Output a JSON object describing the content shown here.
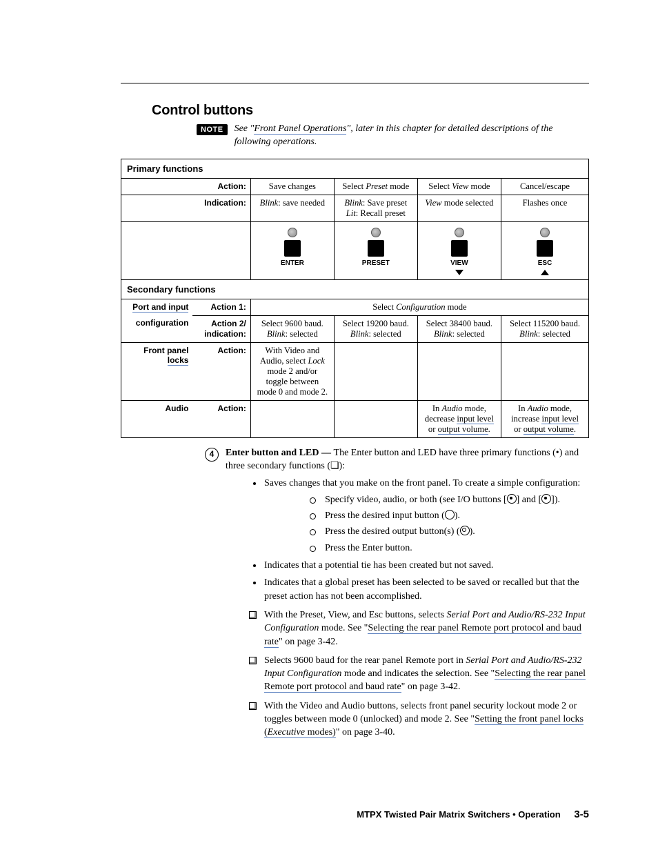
{
  "section_title": "Control buttons",
  "note": {
    "badge": "NOTE",
    "text_prefix": "See \"",
    "link": "Front Panel Operations",
    "text_suffix": "\", later in this chapter for detailed descriptions of the following operations."
  },
  "table": {
    "primary_header": "Primary functions",
    "secondary_header": "Secondary functions",
    "labels": {
      "action": "Action:",
      "indication": "Indication:",
      "action1": "Action 1:",
      "action2": "Action 2/ indication:",
      "port_input": "Port and input",
      "configuration": "configuration",
      "front_panel": "Front panel",
      "locks": "locks",
      "audio": "Audio"
    },
    "primary": {
      "action": [
        "Save changes",
        "Select Preset mode",
        "Select View mode",
        "Cancel/escape"
      ],
      "indication": [
        "Blink: save needed",
        "Blink: Save preset\nLit: Recall preset",
        "View mode selected",
        "Flashes once"
      ]
    },
    "buttons": [
      "ENTER",
      "PRESET",
      "VIEW",
      "ESC"
    ],
    "sec_action1": "Select Configuration mode",
    "sec_action2": [
      "Select 9600 baud.\nBlink: selected",
      "Select 19200 baud.\nBlink: selected",
      "Select 38400 baud.\nBlink: selected",
      "Select 115200 baud.\nBlink: selected"
    ],
    "locks_action": "With Video and Audio, select Lock mode 2 and/or toggle between mode 0 and mode 2.",
    "audio_actions": {
      "view": "In Audio mode, decrease input level or output volume.",
      "esc": "In Audio mode, increase input level or output volume."
    }
  },
  "item": {
    "num": "4",
    "lead": "Enter button and LED — ",
    "lead_rest": "The Enter button and LED have three primary functions (•) and three secondary functions (❏):",
    "bul1": "Saves changes that you make on the front panel.  To create a simple configuration:",
    "circ": [
      "Specify video, audio, or both (see I/O buttons [",
      "Press the desired input button (",
      "Press the desired output button(s) (",
      "Press the Enter button."
    ],
    "circ_tail": [
      "] and [",
      "]).",
      ").",
      ")."
    ],
    "bul2": "Indicates that a potential tie has been created but not saved.",
    "bul3": "Indicates that a global preset has been selected to be saved or recalled but that the preset action has not been accomplished.",
    "sq1a": "With the Preset, View, and Esc buttons, selects ",
    "sq1i": "Serial Port and Audio/RS-232 Input Configuration",
    "sq1b": " mode.  See \"",
    "sq1link": "Selecting the rear panel Remote port protocol and baud rate",
    "sq1c": "\" on page 3-42.",
    "sq2a": "Selects 9600 baud for the rear panel Remote port in ",
    "sq2i": "Serial Port and Audio/RS-232 Input Configuration",
    "sq2b": " mode and indicates the selection.  See \"",
    "sq2link": "Selecting the rear panel Remote port protocol and baud rate",
    "sq2c": "\" on page 3-42.",
    "sq3a": "With the Video and Audio buttons, selects front panel security lockout mode 2 or toggles between mode 0 (unlocked) and mode 2.  See \"",
    "sq3link": "Setting the front panel locks (",
    "sq3i": "Executive",
    "sq3link2": " modes)",
    "sq3c": "\" on page 3-40."
  },
  "footer": {
    "title": "MTPX Twisted Pair Matrix Switchers • Operation",
    "page": "3-5"
  }
}
